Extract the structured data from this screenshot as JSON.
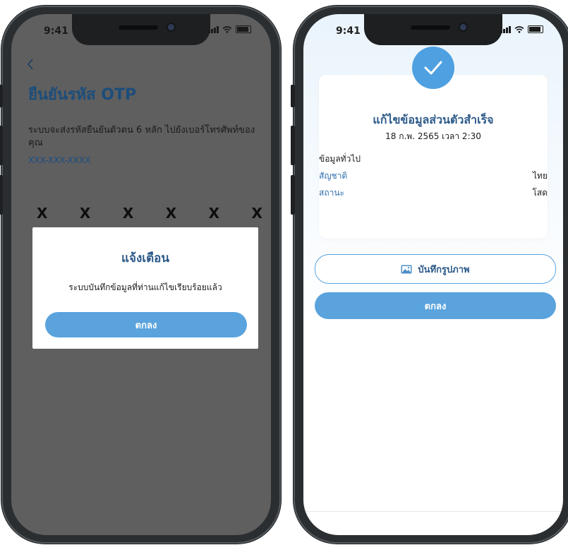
{
  "left_phone": {
    "status_time": "9:41",
    "back_icon": "chevron-left-icon",
    "title": "ยืนยันรหัส OTP",
    "description": "ระบบจะส่งรหัสยืนยันตัวตน 6 หลัก ไปยังเบอร์โทรศัพท์ของคุณ",
    "phone_mask": "XXX-XXX-XXXX",
    "otp_digits": [
      "X",
      "X",
      "X",
      "X",
      "X",
      "X"
    ],
    "modal": {
      "title": "แจ้งเตือน",
      "message": "ระบบบันทึกข้อมูลที่ท่านแก้ไขเรียบร้อยแล้ว",
      "ok_label": "ตกลง"
    }
  },
  "right_phone": {
    "status_time": "9:41",
    "success_icon": "check-icon",
    "card": {
      "title": "แก้ไขข้อมูลส่วนตัวสำเร็จ",
      "date": "18 ก.พ. 2565 เวลา 2:30",
      "section_label": "ข้อมูลทั่วไป",
      "rows": [
        {
          "key": "สัญชาติ",
          "value": "ไทย"
        },
        {
          "key": "สถานะ",
          "value": "โสด"
        }
      ]
    },
    "save_image_icon": "image-icon",
    "save_image_label": "บันทึกรูปภาพ",
    "ok_label": "ตกลง"
  },
  "colors": {
    "accent": "#5aa3dd",
    "title_blue": "#2d5a8a",
    "overlay_gray": "#5f5f5f",
    "frame": "#2b2e31"
  }
}
